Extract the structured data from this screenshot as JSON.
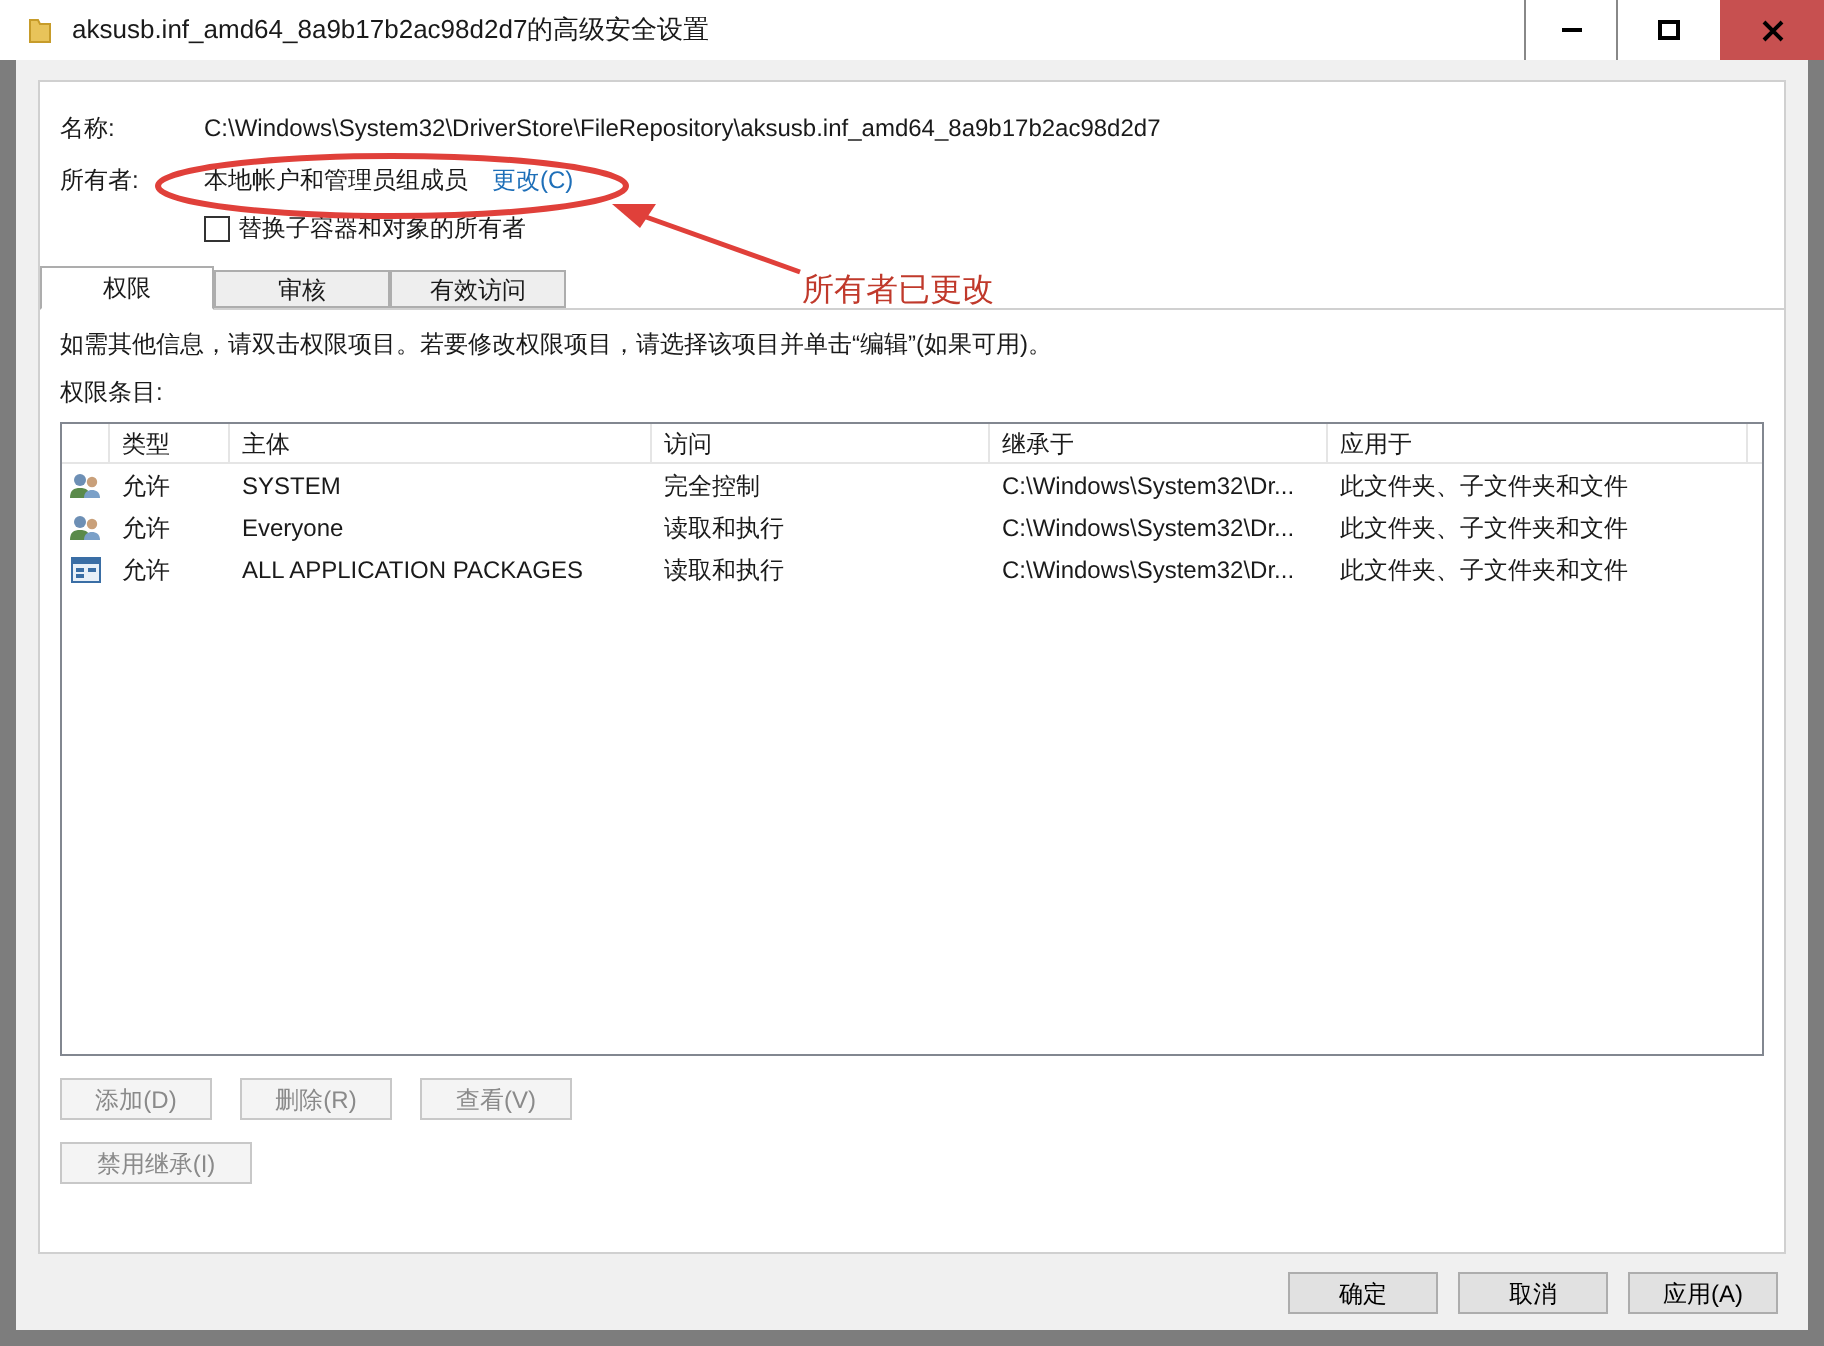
{
  "window": {
    "title": "aksusb.inf_amd64_8a9b17b2ac98d2d7的高级安全设置"
  },
  "fields": [
    {
      "label": "名称:",
      "value": "C:\\Windows\\System32\\DriverStore\\FileRepository\\aksusb.inf_amd64_8a9b17b2ac98d2d7"
    },
    {
      "label": "所有者:",
      "value": "本地帐户和管理员组成员",
      "link": "更改(C)"
    }
  ],
  "replace_owner": {
    "label": "替换子容器和对象的所有者",
    "checked": false
  },
  "annotation": {
    "text": "所有者已更改"
  },
  "tabs": [
    {
      "label": "权限",
      "selected": true
    },
    {
      "label": "审核",
      "selected": false
    },
    {
      "label": "有效访问",
      "selected": false
    }
  ],
  "info": "如需其他信息，请双击权限项目。若要修改权限项目，请选择该项目并单击“编辑”(如果可用)。",
  "list_label": "权限条目:",
  "table": {
    "columns": [
      "类型",
      "主体",
      "访问",
      "继承于",
      "应用于"
    ],
    "rows": [
      {
        "kind": "group",
        "cells": [
          "允许",
          "SYSTEM",
          "完全控制",
          "C:\\Windows\\System32\\Dr...",
          "此文件夹、子文件夹和文件"
        ]
      },
      {
        "kind": "group",
        "cells": [
          "允许",
          "Everyone",
          "读取和执行",
          "C:\\Windows\\System32\\Dr...",
          "此文件夹、子文件夹和文件"
        ]
      },
      {
        "kind": "package",
        "cells": [
          "允许",
          "ALL APPLICATION PACKAGES",
          "读取和执行",
          "C:\\Windows\\System32\\Dr...",
          "此文件夹、子文件夹和文件"
        ]
      }
    ]
  },
  "actions": [
    {
      "label": "添加(D)",
      "disabled": true
    },
    {
      "label": "删除(R)",
      "disabled": true
    },
    {
      "label": "查看(V)",
      "disabled": true
    }
  ],
  "inheritance_button": {
    "label": "禁用继承(I)",
    "disabled": true
  },
  "footer_buttons": [
    {
      "label": "确定",
      "disabled": false
    },
    {
      "label": "取消",
      "disabled": false
    },
    {
      "label": "应用(A)",
      "disabled": false
    }
  ]
}
